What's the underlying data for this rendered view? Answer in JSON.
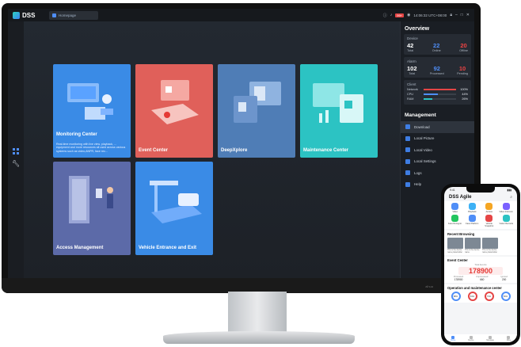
{
  "app": {
    "name": "DSS",
    "tab_label": "Homepage",
    "alarm_badge": "99+",
    "clock": "14:06:32  UTC+08:00"
  },
  "cards": [
    {
      "label": "Monitoring Center",
      "desc": "Real-time monitoring with live view, playback, ... equipment and more resources all used across various systems such as video,ANPR, face rec...",
      "color": "#3a8be6"
    },
    {
      "label": "Event Center",
      "color": "#e0605a"
    },
    {
      "label": "DeepXplore",
      "color": "#4f7db6"
    },
    {
      "label": "Maintenance Center",
      "color": "#2cc3c3"
    },
    {
      "label": "Access Management",
      "color": "#5c6aa8"
    },
    {
      "label": "Vehicle Entrance and Exit",
      "color": "#3a8be6"
    }
  ],
  "overview": {
    "title": "Overview",
    "device": {
      "title": "Device",
      "total": "42",
      "total_l": "Total",
      "online": "22",
      "online_l": "Online",
      "offline": "20",
      "offline_l": "Offline"
    },
    "alarm": {
      "title": "Alarm",
      "total": "102",
      "total_l": "Total",
      "processed": "92",
      "processed_l": "Processed",
      "pending": "10",
      "pending_l": "Pending"
    },
    "client": {
      "title": "Client",
      "rows": [
        {
          "label": "Network",
          "value": "100%",
          "fraction": 1.0,
          "color": "#e54545"
        },
        {
          "label": "CPU",
          "value": "44%",
          "fraction": 0.44,
          "color": "#4f8ef7"
        },
        {
          "label": "RAM",
          "value": "26%",
          "fraction": 0.26,
          "color": "#2cc3c3"
        }
      ]
    }
  },
  "management": {
    "title": "Management",
    "items": [
      "Download",
      "Local Picture",
      "Local Video",
      "Local Settings",
      "Logs",
      "Help"
    ]
  },
  "phone": {
    "time": "9:41",
    "title": "DSS Agile",
    "apps": [
      {
        "label": "Video",
        "color": "#4f8ef7"
      },
      {
        "label": "Playback",
        "color": "#3db1f5"
      },
      {
        "label": "Access",
        "color": "#f5a623"
      },
      {
        "label": "Video Intercom",
        "color": "#7b61ff"
      },
      {
        "label": "Face Recognit.",
        "color": "#22c55e"
      },
      {
        "label": "Face Platform",
        "color": "#4f8ef7"
      },
      {
        "label": "Vehicle Snapshot",
        "color": "#e54545"
      },
      {
        "label": "Visitor Records",
        "color": "#2cc3c3"
      }
    ],
    "recent_title": "Recent Browsing",
    "recent": [
      "This is the device name placeholder",
      "This is the device name",
      "This is the device name placeholder"
    ],
    "event_title": "Event Center",
    "event_total_label": "Total Events",
    "event_total": "178900",
    "event_cells": [
      {
        "label": "Processed",
        "value": "178900"
      },
      {
        "label": "Unprocessed",
        "value": "660"
      },
      {
        "label": "Ignored",
        "value": "200"
      }
    ],
    "om_title": "Operation and maintenance center",
    "om_rings": [
      "88%",
      "63%",
      "73%",
      "50%"
    ],
    "tabs": [
      "Home",
      "Device",
      "Message",
      "Mine"
    ]
  }
}
